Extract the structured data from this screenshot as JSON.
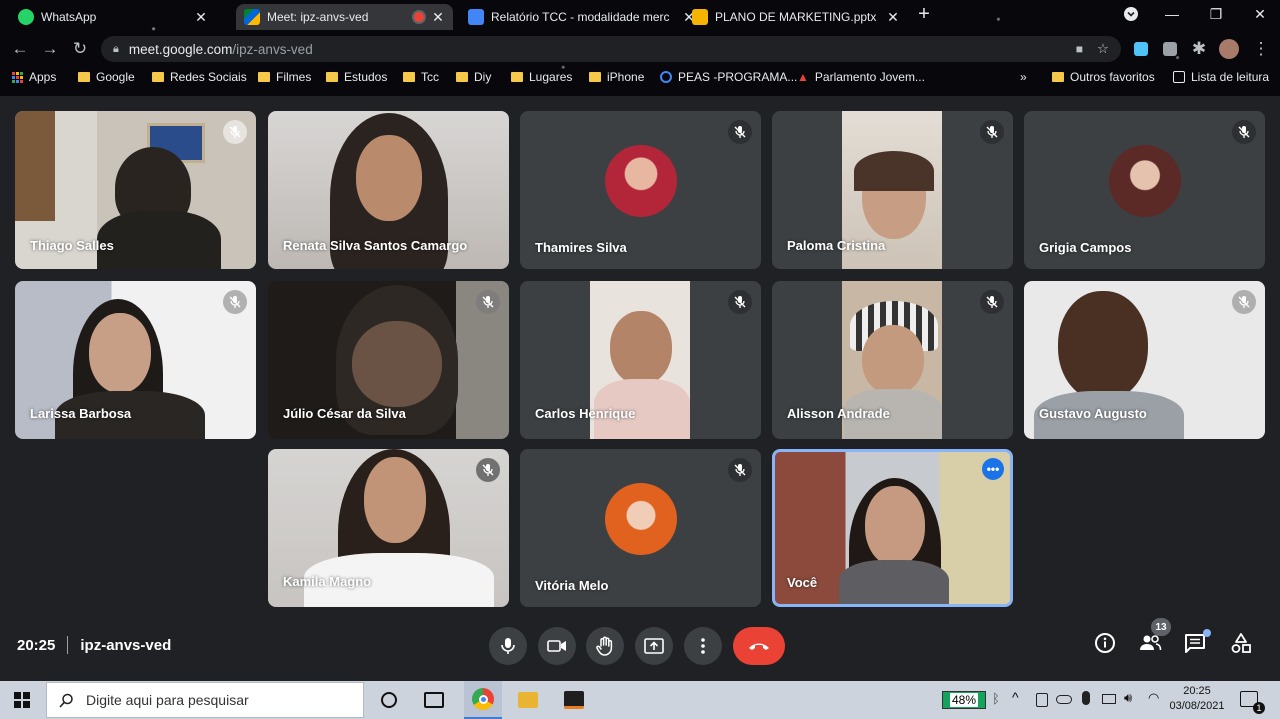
{
  "browser": {
    "tabs": [
      {
        "label": "WhatsApp",
        "icon": "whatsapp-icon"
      },
      {
        "label": "Meet: ipz-anvs-ved",
        "icon": "meet-icon"
      },
      {
        "label": "Relatório TCC - modalidade merc",
        "icon": "docs-icon"
      },
      {
        "label": "PLANO DE MARKETING.pptx - Ap",
        "icon": "slides-icon"
      }
    ],
    "url_host": "meet.google.com",
    "url_path": "/ipz-anvs-ved",
    "bookmarks": [
      "Apps",
      "Google",
      "Redes Sociais",
      "Filmes",
      "Estudos",
      "Tcc",
      "Diy",
      "Lugares",
      "iPhone",
      "PEAS -PROGRAMA...",
      "Parlamento Jovem..."
    ],
    "other_bookmarks": "Outros favoritos",
    "reading_list": "Lista de leitura"
  },
  "participants": [
    {
      "name": "Thiago Salles",
      "kind": "video"
    },
    {
      "name": "Renata Silva Santos Camargo",
      "kind": "video"
    },
    {
      "name": "Thamires Silva",
      "kind": "avatar"
    },
    {
      "name": "Paloma Cristina",
      "kind": "video"
    },
    {
      "name": "Grigia Campos",
      "kind": "avatar"
    },
    {
      "name": "Larissa Barbosa",
      "kind": "video"
    },
    {
      "name": "Júlio César da Silva",
      "kind": "video"
    },
    {
      "name": "Carlos Henrique",
      "kind": "video"
    },
    {
      "name": "Alisson Andrade",
      "kind": "video"
    },
    {
      "name": "Gustavo Augusto",
      "kind": "video"
    },
    {
      "name": "Kamila Magno",
      "kind": "video"
    },
    {
      "name": "Vitória Melo",
      "kind": "avatar"
    },
    {
      "name": "Você",
      "kind": "self"
    }
  ],
  "meeting": {
    "time": "20:25",
    "code": "ipz-anvs-ved",
    "participant_count": "13"
  },
  "taskbar": {
    "search_placeholder": "Digite aqui para pesquisar",
    "battery": "48%",
    "time": "20:25",
    "date": "03/08/2021",
    "notifications": "1"
  },
  "colors": {
    "accent": "#8ab4f8",
    "hangup": "#ea4335",
    "tile": "#3c4043",
    "background": "#202124"
  }
}
